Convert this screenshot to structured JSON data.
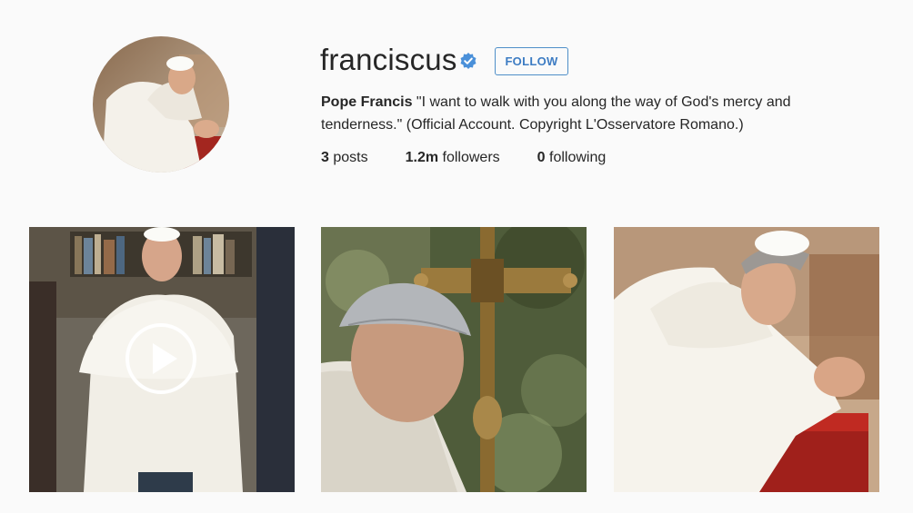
{
  "profile": {
    "username": "franciscus",
    "follow_label": "FOLLOW",
    "bio_name": "Pope Francis",
    "bio_text": " \"I want to walk with you along the way of God's mercy and tenderness.\" (Official Account. Copyright L'Osservatore Romano.)",
    "verified_icon": "verified-badge-icon",
    "verified_color": "#4a90d9"
  },
  "stats": {
    "posts_count": "3",
    "posts_label": " posts",
    "followers_count": "1.2m",
    "followers_label": " followers",
    "following_count": "0",
    "following_label": " following"
  },
  "posts": [
    {
      "kind": "video",
      "icon": "play-icon"
    },
    {
      "kind": "photo"
    },
    {
      "kind": "photo"
    }
  ]
}
